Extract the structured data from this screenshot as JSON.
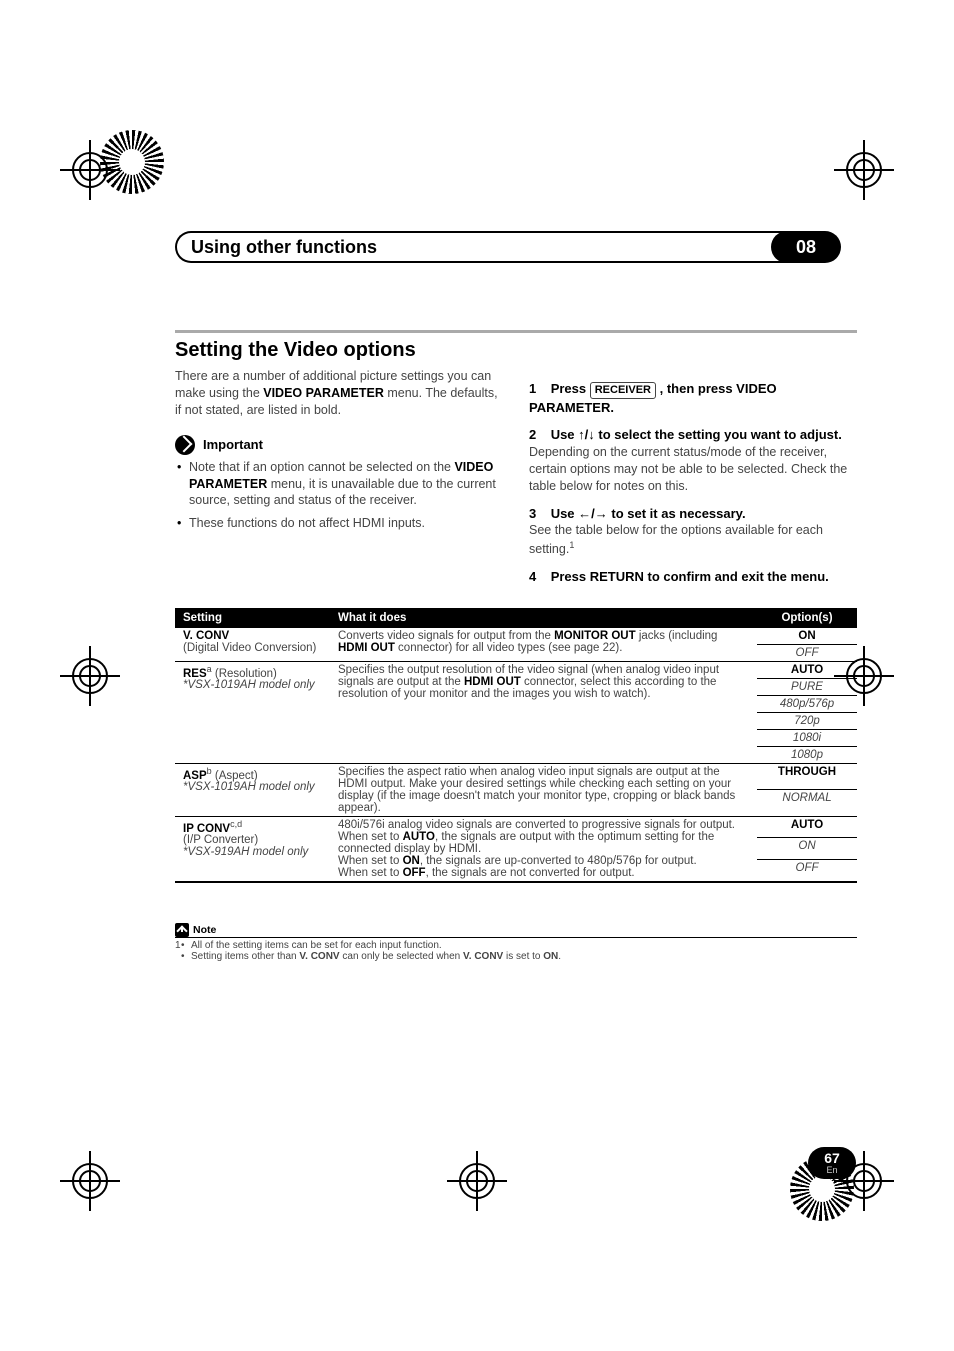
{
  "header": {
    "title": "Using other functions",
    "chapter": "08"
  },
  "section": {
    "heading": "Setting the Video options",
    "intro_pre": "There are a number of additional picture settings you can make using the ",
    "intro_b1": "VIDEO PARAMETER",
    "intro_post": " menu. The defaults, if not stated, are listed in bold.",
    "important_label": "Important",
    "bullet1_pre": "Note that if an option cannot be selected on the ",
    "bullet1_b": "VIDEO PARAMETER",
    "bullet1_post": " menu, it is unavailable due to the current source, setting and status of the receiver.",
    "bullet2": "These functions do not affect HDMI inputs."
  },
  "steps": {
    "s1_num": "1",
    "s1_a": "Press ",
    "s1_btn": "RECEIVER",
    "s1_b": " , then press VIDEO PARAMETER.",
    "s2_num": "2",
    "s2_a": "Use ",
    "s2_arrows": "↑/↓",
    "s2_b": " to select the setting you want to adjust.",
    "s2_desc": "Depending on the current status/mode of the receiver, certain options may not be able to be selected. Check the table below for notes on this.",
    "s3_num": "3",
    "s3_a": "Use ",
    "s3_arrows": "←/→",
    "s3_b": " to set it as necessary.",
    "s3_desc": "See the table below for the options available for each setting.",
    "s3_sup": "1",
    "s4_num": "4",
    "s4_text": "Press RETURN to confirm and exit the menu."
  },
  "table": {
    "h_setting": "Setting",
    "h_what": "What it does",
    "h_options": "Option(s)",
    "r1_name": "V. CONV",
    "r1_sub": "(Digital Video Conversion)",
    "r1_desc_a": "Converts video signals for output from the ",
    "r1_desc_b1": "MONITOR OUT",
    "r1_desc_b": " jacks (including ",
    "r1_desc_b2": "HDMI OUT",
    "r1_desc_c": " connector) for all video types (see page 22).",
    "r1_opt1": "ON",
    "r1_opt2": "OFF",
    "r2_name": "RES",
    "r2_sup": "a",
    "r2_role": " (Resolution)",
    "r2_model": "*VSX-1019AH model only",
    "r2_desc_a": "Specifies the output resolution of the video signal (when analog video input signals are output at the ",
    "r2_desc_b": "HDMI OUT",
    "r2_desc_c": " connector, select this according to the resolution of your monitor and the images you wish to watch).",
    "r2_o1": "AUTO",
    "r2_o2": "PURE",
    "r2_o3": "480p/576p",
    "r2_o4": "720p",
    "r2_o5": "1080i",
    "r2_o6": "1080p",
    "r3_name": "ASP",
    "r3_sup": "b",
    "r3_role": " (Aspect)",
    "r3_model": "*VSX-1019AH model only",
    "r3_desc": "Specifies the aspect ratio when analog video input signals are output at the HDMI output. Make your desired settings while checking each setting on your display (if the image doesn't match your monitor type, cropping or black bands appear).",
    "r3_o1": "THROUGH",
    "r3_o2": "NORMAL",
    "r4_name": "IP  CONV",
    "r4_sup": "c,d",
    "r4_role": "(I/P Converter)",
    "r4_model": "*VSX-919AH model only",
    "r4_p1": "480i/576i analog video signals are converted to progressive signals for output.",
    "r4_p2a": "When set to ",
    "r4_p2b": "AUTO",
    "r4_p2c": ", the signals are output with the optimum setting for the connected display by HDMI.",
    "r4_p3a": "When set to ",
    "r4_p3b": "ON",
    "r4_p3c": ", the signals are up-converted to 480p/576p for output.",
    "r4_p4a": "When set to ",
    "r4_p4b": "OFF",
    "r4_p4c": ", the signals are not converted for output.",
    "r4_o1": "AUTO",
    "r4_o2": "ON",
    "r4_o3": "OFF"
  },
  "note": {
    "label": "Note",
    "lead": "1",
    "b1": "All of the setting items can be set for each input function.",
    "b2a": "Setting items other than ",
    "b2b": "V. CONV",
    "b2c": " can only be selected when ",
    "b2d": "V. CONV",
    "b2e": " is set to ",
    "b2f": "ON",
    "b2g": "."
  },
  "page": {
    "num": "67",
    "lang": "En"
  }
}
